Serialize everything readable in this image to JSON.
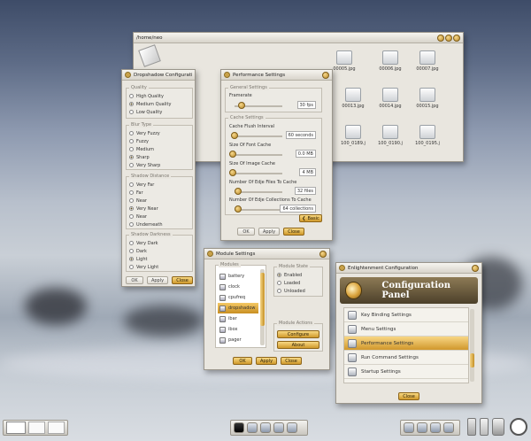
{
  "filemanager": {
    "title": "/home/neo",
    "files": [
      {
        "name": "00005.jpg"
      },
      {
        "name": "00006.jpg"
      },
      {
        "name": "00007.jpg"
      },
      {
        "name": "00013.jpg"
      },
      {
        "name": "00014.jpg"
      },
      {
        "name": "00015.jpg"
      },
      {
        "name": "100_0189.j"
      },
      {
        "name": "100_0190.j"
      },
      {
        "name": "100_0195.j"
      }
    ]
  },
  "dropshadow": {
    "title": "Dropshadow Configuration",
    "quality": {
      "title": "Quality",
      "options": [
        "High Quality",
        "Medium Quality",
        "Low Quality"
      ],
      "selected": 1
    },
    "blur": {
      "title": "Blur Type",
      "options": [
        "Very Fuzzy",
        "Fuzzy",
        "Medium",
        "Sharp",
        "Very Sharp"
      ],
      "selected": 3
    },
    "distance": {
      "title": "Shadow Distance",
      "options": [
        "Very Far",
        "Far",
        "Near",
        "Very Near",
        "Near",
        "Underneath"
      ],
      "selected": 3
    },
    "darkness": {
      "title": "Shadow Darkness",
      "options": [
        "Very Dark",
        "Dark",
        "Light",
        "Very Light"
      ],
      "selected": 2
    },
    "buttons": {
      "ok": "OK",
      "apply": "Apply",
      "close": "Close"
    }
  },
  "performance": {
    "title": "Performance Settings",
    "general_title": "General Settings",
    "framerate_label": "Framerate",
    "framerate_value": "30 fps",
    "cache_title": "Cache Settings",
    "cache_flush_label": "Cache Flush Interval",
    "cache_flush_value": "60 seconds",
    "font_cache_label": "Size Of Font Cache",
    "font_cache_value": "0.0 MB",
    "image_cache_label": "Size Of Image Cache",
    "image_cache_value": "4 MB",
    "edje_files_label": "Number Of Edje Files To Cache",
    "edje_files_value": "32 files",
    "edje_coll_label": "Number Of Edje Collections To Cache",
    "edje_coll_value": "64 collections",
    "basic_label": "Basic",
    "buttons": {
      "ok": "OK",
      "apply": "Apply",
      "close": "Close"
    }
  },
  "modules": {
    "title": "Module Settings",
    "list_title": "Modules",
    "items": [
      "battery",
      "clock",
      "cpufreq",
      "dropshadow",
      "ibar",
      "ibox",
      "pager"
    ],
    "selected": 3,
    "state_title": "Module State",
    "states": [
      "Enabled",
      "Loaded",
      "Unloaded"
    ],
    "state_selected": 0,
    "actions_title": "Module Actions",
    "configure_label": "Configure",
    "about_label": "About",
    "buttons": {
      "ok": "OK",
      "apply": "Apply",
      "close": "Close"
    }
  },
  "config_panel": {
    "title": "Enlightenment Configuration",
    "heading": "Configuration Panel",
    "items": [
      "Key Binding Settings",
      "Menu Settings",
      "Performance Settings",
      "Run Command Settings",
      "Startup Settings"
    ],
    "selected": 2,
    "close_label": "Close"
  },
  "colors": {
    "accent": "#d09a2c",
    "window_bg": "#e9e6df"
  }
}
